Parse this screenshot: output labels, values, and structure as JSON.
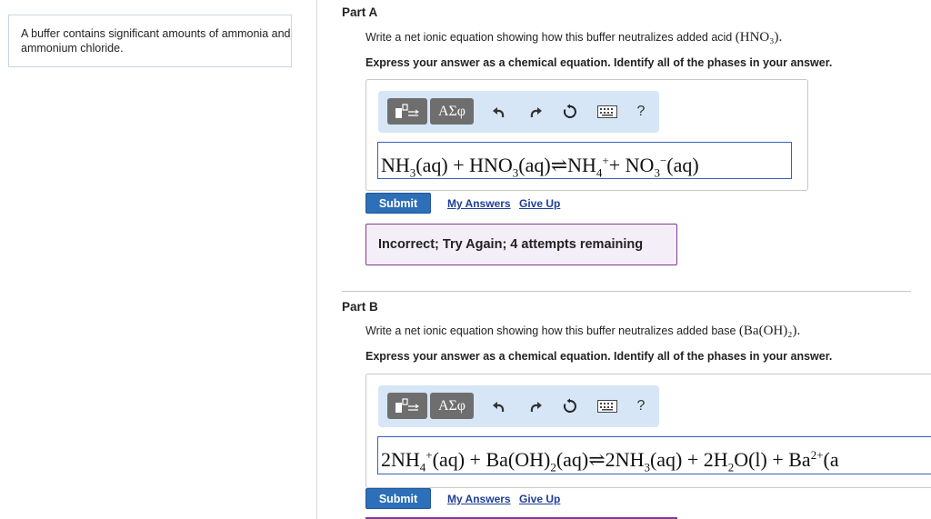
{
  "problem": {
    "text": "A buffer contains significant amounts of ammonia and ammonium chloride."
  },
  "toolbar": {
    "symbols_label": "ΑΣφ",
    "help_label": "?"
  },
  "part_a": {
    "title": "Part A",
    "prompt_text": "Write a net ionic equation showing how this buffer neutralizes added acid",
    "prompt_chem": "(HNO₃).",
    "instruction": "Express your answer as a chemical equation. Identify all of the phases in your answer.",
    "answer": [
      "NH",
      "3",
      "(aq) + HNO",
      "3",
      "(aq)⇌NH",
      "4",
      "+",
      "+ NO",
      "3",
      "−",
      "(aq)"
    ],
    "submit_label": "Submit",
    "my_answers_label": "My Answers",
    "give_up_label": "Give Up",
    "feedback": "Incorrect; Try Again; 4 attempts remaining"
  },
  "part_b": {
    "title": "Part B",
    "prompt_text": "Write a net ionic equation showing how this buffer neutralizes added base",
    "prompt_chem": "(Ba(OH)₂).",
    "instruction": "Express your answer as a chemical equation. Identify all of the phases in your answer.",
    "answer": [
      "2NH",
      "4",
      "+",
      "(aq) + Ba(OH)",
      "2",
      "(aq)⇌2NH",
      "3",
      "(aq) + 2H",
      "2",
      "O(l) + Ba",
      "2+",
      "(a"
    ],
    "submit_label": "Submit",
    "my_answers_label": "My Answers",
    "give_up_label": "Give Up"
  }
}
